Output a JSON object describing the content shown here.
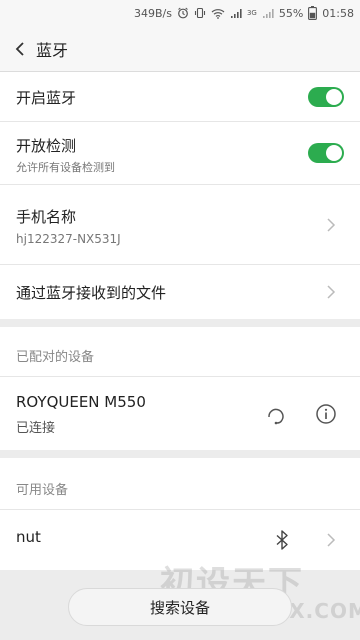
{
  "status_bar": {
    "speed": "349B/s",
    "signal_a": "3G",
    "signal_b": "3G",
    "battery": "55%",
    "time": "01:58"
  },
  "header": {
    "title": "蓝牙"
  },
  "bluetooth": {
    "enable_label": "开启蓝牙",
    "enable_on": true,
    "visible_label": "开放检测",
    "visible_sub": "允许所有设备检测到",
    "visible_on": true,
    "name_label": "手机名称",
    "name_value": "hj122327-NX531J",
    "files_label": "通过蓝牙接收到的文件"
  },
  "paired": {
    "section_label": "已配对的设备",
    "devices": [
      {
        "name": "ROYQUEEN M550",
        "status": "已连接"
      }
    ]
  },
  "available": {
    "section_label": "可用设备",
    "devices": [
      {
        "name": "nut"
      }
    ]
  },
  "search_button": "搜索设备",
  "watermark": {
    "cn": "初设天下",
    "en": "WWW.WSTX.COM"
  },
  "colors": {
    "toggle_on": "#2cac4f",
    "background": "#ececec"
  }
}
